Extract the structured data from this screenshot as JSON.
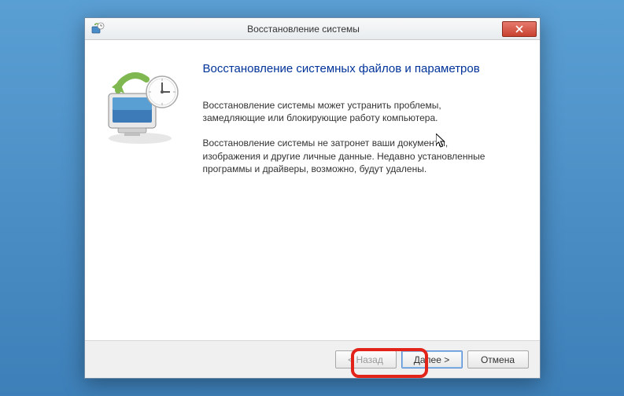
{
  "window": {
    "title": "Восстановление системы"
  },
  "content": {
    "heading": "Восстановление системных файлов и параметров",
    "para1": "Восстановление системы может устранить проблемы, замедляющие или блокирующие работу компьютера.",
    "para2": "Восстановление системы не затронет ваши документы, изображения и другие личные данные. Недавно установленные программы и драйверы, возможно, будут удалены."
  },
  "buttons": {
    "back": "< Назад",
    "next": "Далее >",
    "cancel": "Отмена"
  }
}
